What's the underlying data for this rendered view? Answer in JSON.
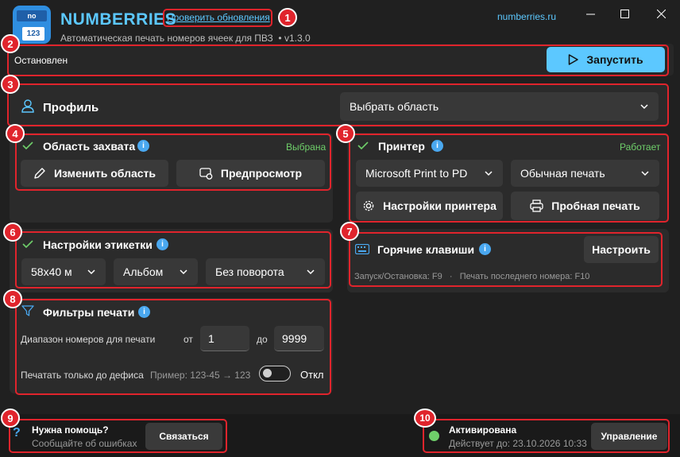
{
  "app": {
    "name": "NUMBERRIES",
    "subtitle": "Автоматическая печать номеров ячеек для ПВЗ",
    "version_sep": "•",
    "version": "v1.3.0",
    "check_updates": "Проверить обновления",
    "website": "numberries.ru",
    "logo_top": "no",
    "logo_bottom": "123"
  },
  "colors": {
    "accent": "#5cc8ff",
    "badge": "#e0242c",
    "success": "#6fcf6a",
    "info": "#4aa8f0"
  },
  "status": {
    "text": "Остановлен",
    "start_label": "Запустить"
  },
  "profile": {
    "label": "Профиль",
    "select_value": "Выбрать область"
  },
  "capture": {
    "title": "Область захвата",
    "state": "Выбрана",
    "edit_label": "Изменить область",
    "preview_label": "Предпросмотр"
  },
  "printer": {
    "title": "Принтер",
    "state": "Работает",
    "printer_value": "Microsoft Print to PD",
    "mode_value": "Обычная печать",
    "settings_label": "Настройки принтера",
    "test_label": "Пробная печать"
  },
  "label_settings": {
    "title": "Настройки этикетки",
    "size_value": "58x40 м",
    "orientation_value": "Альбом",
    "rotation_value": "Без поворота"
  },
  "hotkeys": {
    "title": "Горячие клавиши",
    "configure_label": "Настроить",
    "start_stop": "Запуск/Остановка: F9",
    "sep": "·",
    "print_last": "Печать последнего номера: F10"
  },
  "filters": {
    "title": "Фильтры печати",
    "range_label": "Диапазон номеров для печати",
    "from_label": "от",
    "from_value": "1",
    "to_label": "до",
    "to_value": "9999",
    "hyphen_label": "Печатать только до дефиса",
    "example": "Пример: 123-45 → 123",
    "toggle_state": "Откл"
  },
  "help": {
    "title": "Нужна помощь?",
    "subtitle": "Сообщайте об ошибках",
    "contact_label": "Связаться",
    "icon_glyph": "?"
  },
  "license": {
    "status": "Активирована",
    "valid_until": "Действует до: 23.10.2026 10:33",
    "manage_label": "Управление"
  },
  "badges": [
    "1",
    "2",
    "3",
    "4",
    "5",
    "6",
    "7",
    "8",
    "9",
    "10"
  ],
  "info_glyph": "i"
}
